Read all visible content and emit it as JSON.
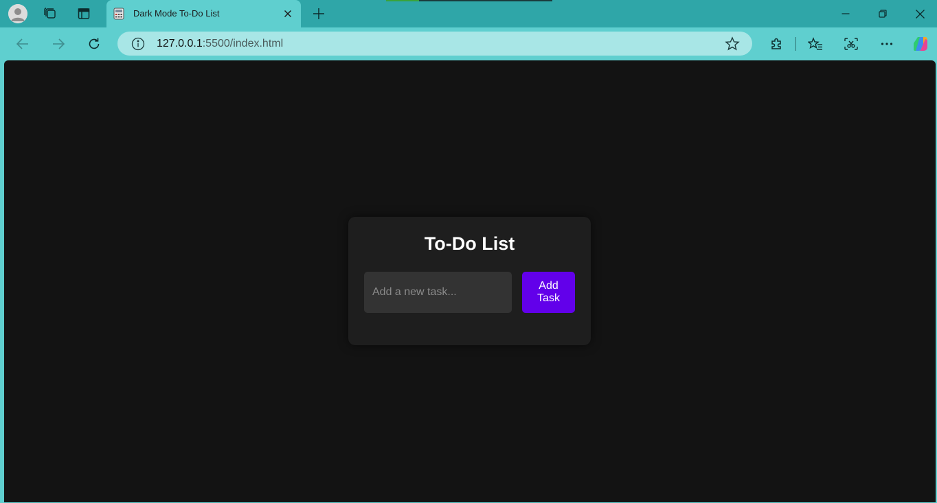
{
  "browser": {
    "tab": {
      "title": "Dark Mode To-Do List"
    },
    "address": {
      "host": "127.0.0.1",
      "path": ":5500/index.html"
    }
  },
  "icons": {
    "profile": "profile-avatar-icon",
    "workspaces": "workspaces-icon",
    "tab_actions": "tab-actions-icon",
    "favicon": "calculator-icon",
    "close": "close-icon",
    "new_tab": "plus-icon",
    "minimize": "minimize-icon",
    "restore": "restore-icon",
    "window_close": "close-icon",
    "back": "back-arrow-icon",
    "forward": "forward-arrow-icon",
    "refresh": "refresh-icon",
    "info": "info-icon",
    "favorite": "star-icon",
    "extensions": "puzzle-icon",
    "favorites": "favorites-icon",
    "screenshot": "screenshot-icon",
    "more": "more-icon",
    "copilot": "copilot-icon"
  },
  "app": {
    "title": "To-Do List",
    "input_placeholder": "Add a new task...",
    "add_button": "Add Task"
  },
  "colors": {
    "chrome": "#2fa6a8",
    "toolbar": "#5fcfcf",
    "page_background": "#131313",
    "card_background": "#1e1e1e",
    "accent": "#6200ea"
  }
}
